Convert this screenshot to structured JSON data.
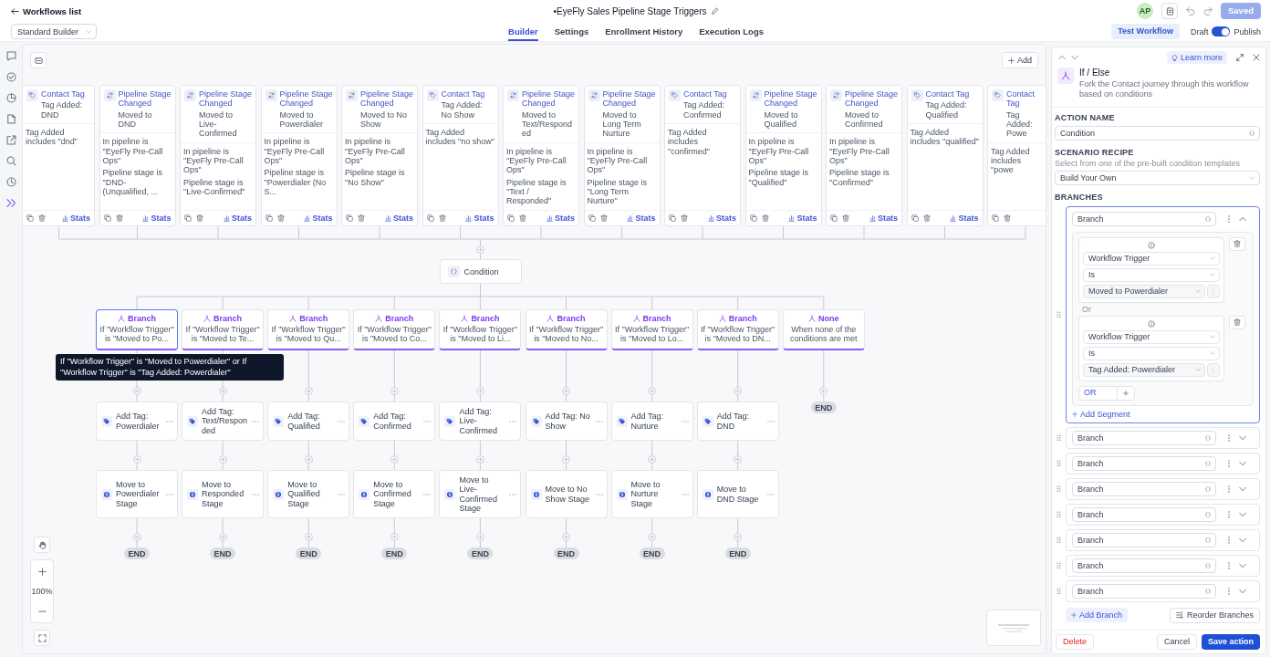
{
  "header": {
    "back_link": "Workflows list",
    "title": "•EyeFly Sales Pipeline Stage Triggers",
    "avatar": "AP",
    "save_button": "Saved"
  },
  "toolbar": {
    "builder_select": "Standard Builder",
    "tabs": [
      {
        "label": "Builder",
        "selected": true
      },
      {
        "label": "Settings",
        "selected": false
      },
      {
        "label": "Enrollment History",
        "selected": false
      },
      {
        "label": "Execution Logs",
        "selected": false
      }
    ],
    "test_button": "Test Workflow",
    "status_toggle": {
      "off_label": "Draft",
      "on_label": "Publish",
      "on": true
    }
  },
  "sidebar": {
    "items": [
      {
        "selected": false
      },
      {
        "selected": false
      },
      {
        "selected": false
      },
      {
        "selected": false
      },
      {
        "selected": false
      },
      {
        "selected": false
      },
      {
        "selected": false
      },
      {
        "selected": true
      }
    ]
  },
  "canvas": {
    "add_button": "Add",
    "triggers": [
      {
        "kind": "tag",
        "title": "Contact Tag",
        "event": "Tag Added: DND",
        "details": [
          "Tag Added includes \"dnd\""
        ],
        "stats": "Stats"
      },
      {
        "kind": "stage",
        "title": "Pipeline Stage Changed",
        "event": "Moved to DND",
        "details": [
          "In pipeline is \"EyeFly Pre-Call Ops\"",
          "Pipeline stage is \"DND-(Unqualified, ..."
        ],
        "stats": "Stats"
      },
      {
        "kind": "stage",
        "title": "Pipeline Stage Changed",
        "event": "Moved to Live-Confirmed",
        "details": [
          "In pipeline is \"EyeFly Pre-Call Ops\"",
          "Pipeline stage is \"Live-Confirmed\""
        ],
        "stats": "Stats"
      },
      {
        "kind": "stage",
        "title": "Pipeline Stage Changed",
        "event": "Moved to Powerdialer",
        "details": [
          "In pipeline is \"EyeFly Pre-Call Ops\"",
          "Pipeline stage is \"Powerdialer (No S..."
        ],
        "stats": "Stats"
      },
      {
        "kind": "stage",
        "title": "Pipeline Stage Changed",
        "event": "Moved to No Show",
        "details": [
          "In pipeline is \"EyeFly Pre-Call Ops\"",
          "Pipeline stage is \"No Show\""
        ],
        "stats": "Stats"
      },
      {
        "kind": "tag",
        "title": "Contact Tag",
        "event": "Tag Added: No Show",
        "details": [
          "Tag Added includes \"no show\""
        ],
        "stats": "Stats"
      },
      {
        "kind": "stage",
        "title": "Pipeline Stage Changed",
        "event": "Moved to Text/Responded",
        "details": [
          "In pipeline is \"EyeFly Pre-Call Ops\"",
          "Pipeline stage is \"Text / Responded\""
        ],
        "stats": "Stats"
      },
      {
        "kind": "stage",
        "title": "Pipeline Stage Changed",
        "event": "Moved to Long Term Nurture",
        "details": [
          "In pipeline is \"EyeFly Pre-Call Ops\"",
          "Pipeline stage is \"Long Term Nurture\""
        ],
        "stats": "Stats"
      },
      {
        "kind": "tag",
        "title": "Contact Tag",
        "event": "Tag Added: Confirmed",
        "details": [
          "Tag Added includes \"confirmed\""
        ],
        "stats": "Stats"
      },
      {
        "kind": "stage",
        "title": "Pipeline Stage Changed",
        "event": "Moved to Qualified",
        "details": [
          "In pipeline is \"EyeFly Pre-Call Ops\"",
          "Pipeline stage is \"Qualified\""
        ],
        "stats": "Stats"
      },
      {
        "kind": "stage",
        "title": "Pipeline Stage Changed",
        "event": "Moved to Confirmed",
        "details": [
          "In pipeline is \"EyeFly Pre-Call Ops\"",
          "Pipeline stage is \"Confirmed\""
        ],
        "stats": "Stats"
      },
      {
        "kind": "tag",
        "title": "Contact Tag",
        "event": "Tag Added: Qualified",
        "details": [
          "Tag Added includes \"qualified\""
        ],
        "stats": "Stats"
      },
      {
        "kind": "tag",
        "title": "Contact Tag",
        "event": "Tag Added: Powe",
        "details": [
          "Tag Added includes \"powe"
        ]
      }
    ],
    "condition": "Condition",
    "branches": [
      {
        "title": "Branch",
        "summary": "If \"Workflow Trigger\" is \"Moved to Po...",
        "selected": true,
        "actions": [
          {
            "kind": "tag",
            "label": "Add Tag: Powerdialer"
          },
          {
            "kind": "stage",
            "label": "Move to Powerdialer Stage"
          }
        ],
        "end": "END"
      },
      {
        "title": "Branch",
        "summary": "If \"Workflow Trigger\" is \"Moved to Te...",
        "selected": false,
        "actions": [
          {
            "kind": "tag",
            "label": "Add Tag: Text/Responded"
          },
          {
            "kind": "stage",
            "label": "Move to Responded Stage"
          }
        ],
        "end": "END"
      },
      {
        "title": "Branch",
        "summary": "If \"Workflow Trigger\" is \"Moved to Qu...",
        "selected": false,
        "actions": [
          {
            "kind": "tag",
            "label": "Add Tag: Qualified"
          },
          {
            "kind": "stage",
            "label": "Move to Qualified Stage"
          }
        ],
        "end": "END"
      },
      {
        "title": "Branch",
        "summary": "If \"Workflow Trigger\" is \"Moved to Co...",
        "selected": false,
        "actions": [
          {
            "kind": "tag",
            "label": "Add Tag: Confirmed"
          },
          {
            "kind": "stage",
            "label": "Move to Confirmed Stage"
          }
        ],
        "end": "END"
      },
      {
        "title": "Branch",
        "summary": "If \"Workflow Trigger\" is \"Moved to Li...",
        "selected": false,
        "actions": [
          {
            "kind": "tag",
            "label": "Add Tag: Live-Confirmed"
          },
          {
            "kind": "stage",
            "label": "Move to Live-Confirmed Stage"
          }
        ],
        "end": "END"
      },
      {
        "title": "Branch",
        "summary": "If \"Workflow Trigger\" is \"Moved to No...",
        "selected": false,
        "actions": [
          {
            "kind": "tag",
            "label": "Add Tag: No Show"
          },
          {
            "kind": "stage",
            "label": "Move to No Show Stage"
          }
        ],
        "end": "END"
      },
      {
        "title": "Branch",
        "summary": "If \"Workflow Trigger\" is \"Moved to Lo...",
        "selected": false,
        "actions": [
          {
            "kind": "tag",
            "label": "Add Tag: Nurture"
          },
          {
            "kind": "stage",
            "label": "Move to Nurture Stage"
          }
        ],
        "end": "END"
      },
      {
        "title": "Branch",
        "summary": "If \"Workflow Trigger\" is \"Moved to DN...",
        "selected": false,
        "actions": [
          {
            "kind": "tag",
            "label": "Add Tag: DND"
          },
          {
            "kind": "stage",
            "label": "Move to DND Stage"
          }
        ],
        "end": "END"
      },
      {
        "title": "None",
        "summary": "When none of the conditions are met",
        "selected": false,
        "end": "END"
      }
    ],
    "tooltip": "If \"Workflow Trigger\" is \"Moved to Powerdialer\" or If \"Workflow Trigger\" is \"Tag Added: Powerdialer\"",
    "zoom_level": "100%"
  },
  "panel": {
    "learn_more": "Learn more",
    "title": "If / Else",
    "description": "Fork the Contact journey through this workflow based on conditions",
    "action_name": {
      "label": "ACTION NAME",
      "value": "Condition"
    },
    "scenario_recipe": {
      "label": "SCENARIO RECIPE",
      "hint": "Select from one of the pre-built condition templates",
      "value": "Build Your Own"
    },
    "branches_label": "BRANCHES",
    "branches": [
      {
        "name": "Branch",
        "expanded": true,
        "segments": [
          {
            "field": "Workflow Trigger",
            "operator": "Is",
            "value": "Moved to Powerdialer"
          },
          {
            "field": "Workflow Trigger",
            "operator": "Is",
            "value": "Tag Added: Powerdialer"
          }
        ],
        "joiner": "Or",
        "or_button": "OR",
        "add_segment": "Add Segment"
      },
      {
        "name": "Branch",
        "expanded": false
      },
      {
        "name": "Branch",
        "expanded": false
      },
      {
        "name": "Branch",
        "expanded": false
      },
      {
        "name": "Branch",
        "expanded": false
      },
      {
        "name": "Branch",
        "expanded": false
      },
      {
        "name": "Branch",
        "expanded": false
      },
      {
        "name": "Branch",
        "expanded": false
      }
    ],
    "add_branch": "Add Branch",
    "reorder_branches": "Reorder Branches",
    "delete_button": "Delete",
    "cancel_button": "Cancel",
    "save_button": "Save action"
  }
}
